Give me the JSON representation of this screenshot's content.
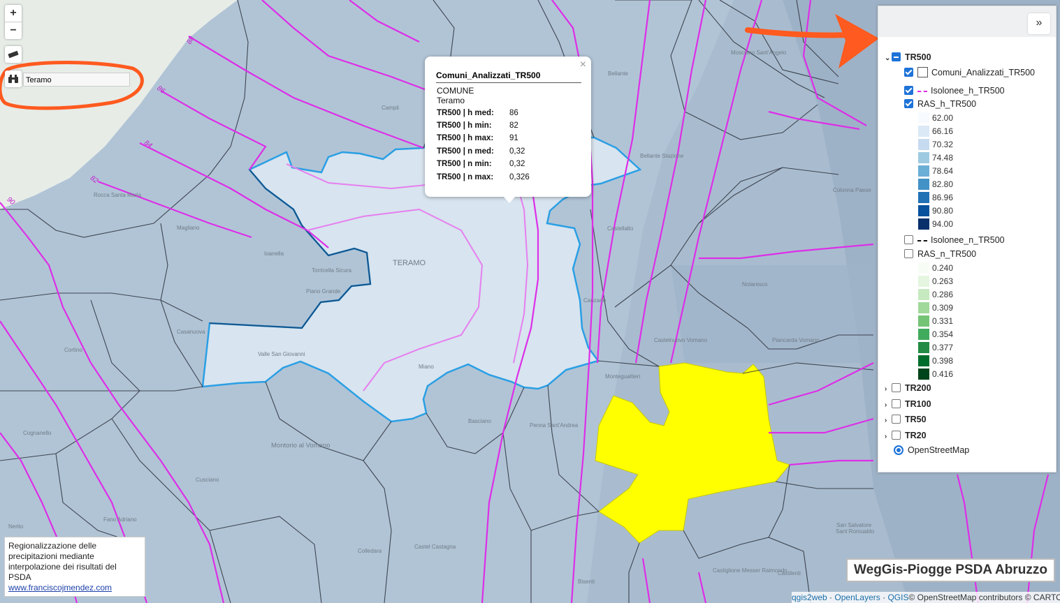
{
  "map": {
    "zoom_in": "+",
    "zoom_out": "−",
    "search": {
      "value": "Teramo"
    },
    "place_labels": [
      "Mosciano Sant'Angelo",
      "Bellante",
      "Campli",
      "Bellante Stazione",
      "Colonna Paese",
      "Rocca Santa Maria",
      "Magliano",
      "Castellalto",
      "Ioanella",
      "Torricella Sicura",
      "TERAMO",
      "Piano Grande",
      "Notaresco",
      "Casanuova",
      "Canzano",
      "Castelnuovo Vomano",
      "Cortino",
      "Valle San Giovanni",
      "Miano",
      "Montegualtieri",
      "Piancarda Vomano",
      "Cognanello",
      "Basciano",
      "Penna Sant'Andrea",
      "Montorio al Vomano",
      "Cusciano",
      "Fano Adriano",
      "Nerito",
      "Castel Castagna",
      "Colledara",
      "Bisenti",
      "Castiglione Messer Raimondo",
      "Castilenti",
      "San Salvatore",
      "Sant Romualdo"
    ],
    "isoline_labels": [
      "88",
      "86",
      "84",
      "82",
      "90"
    ],
    "highlight_color": "#ffff00",
    "selected_outline_color": "#1c9be6"
  },
  "popup": {
    "title": "Comuni_Analizzati_TR500",
    "close": "×",
    "field_label": "COMUNE",
    "field_value": "Teramo",
    "rows": [
      {
        "k": "TR500 | h med:",
        "v": "86"
      },
      {
        "k": "TR500 | h min:",
        "v": "82"
      },
      {
        "k": "TR500 | h max:",
        "v": "91"
      },
      {
        "k": "TR500 | n med:",
        "v": "0,32"
      },
      {
        "k": "TR500 | n min:",
        "v": "0,32"
      },
      {
        "k": "TR500 | n max:",
        "v": "0,326"
      }
    ]
  },
  "layers": {
    "collapse": "»",
    "group": "TR500",
    "children": [
      "Comuni_Analizzati_TR500",
      "Isolonee_h_TR500",
      "RAS_h_TR500",
      "Isolonee_n_TR500",
      "RAS_n_TR500"
    ],
    "ras_h_legend": [
      "62.00",
      "66.16",
      "70.32",
      "74.48",
      "78.64",
      "82.80",
      "86.96",
      "90.80",
      "94.00"
    ],
    "ras_h_colors": [
      "#f7fbff",
      "#dbe9f6",
      "#c6dbef",
      "#9ecae1",
      "#6baed6",
      "#4292c6",
      "#2171b5",
      "#08519c",
      "#08306b"
    ],
    "ras_n_legend": [
      "0.240",
      "0.263",
      "0.286",
      "0.309",
      "0.331",
      "0.354",
      "0.377",
      "0.398",
      "0.416"
    ],
    "ras_n_colors": [
      "#f7fcf5",
      "#e5f5e0",
      "#c7e9c0",
      "#a1d99b",
      "#74c476",
      "#41ab5d",
      "#238b45",
      "#006d2c",
      "#00441b"
    ],
    "other_groups": [
      "TR200",
      "TR100",
      "TR50",
      "TR20"
    ],
    "basemap": "OpenStreetMap"
  },
  "note": {
    "text": "Regionalizzazione delle precipitazioni mediante interpolazione dei risultati del PSDA",
    "link": "www.franciscojmendez.com"
  },
  "title": "WegGis-Piogge PSDA Abruzzo",
  "attribution": {
    "qgis2web": "qgis2web",
    "openlayers": "OpenLayers",
    "qgis": "QGIS",
    "osm": "© OpenStreetMap contributors © CARTO",
    "sep": "·"
  }
}
